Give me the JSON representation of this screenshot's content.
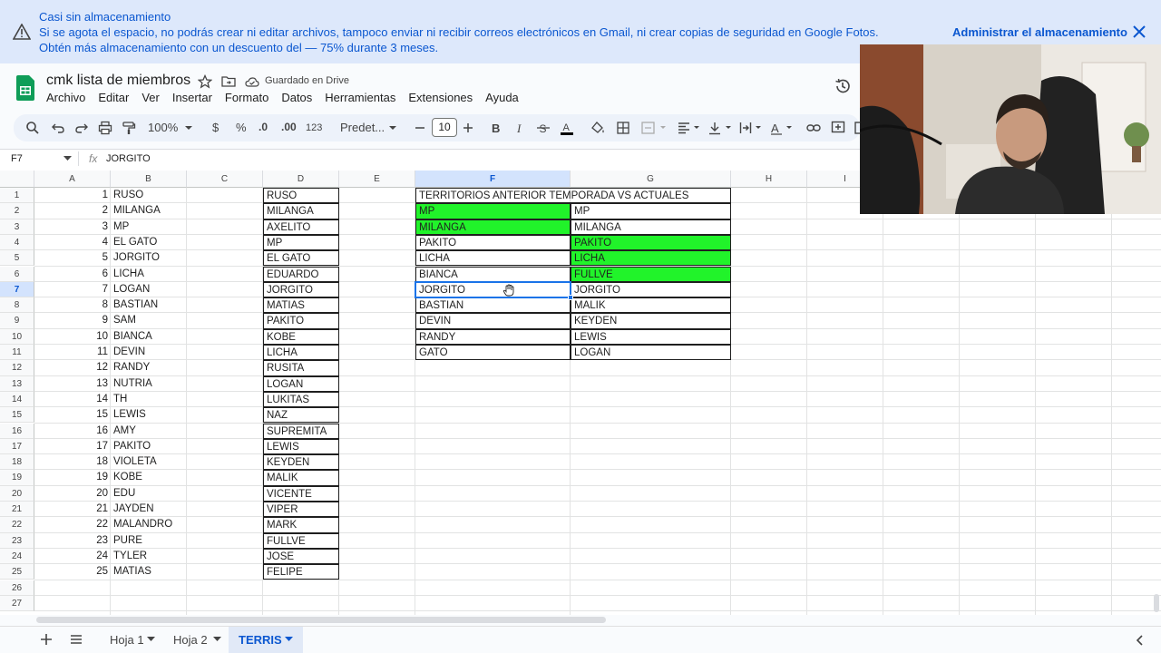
{
  "banner": {
    "title": "Casi sin almacenamiento",
    "message": "Si se agota el espacio, no podrás crear ni editar archivos, tampoco enviar ni recibir correos electrónicos en Gmail, ni crear copias de seguridad en Google Fotos. Obtén más almacenamiento con un descuento del — 75% durante 3 meses.",
    "action": "Administrar el almacenamiento"
  },
  "doc": {
    "title": "cmk lista de miembros",
    "saved": "Guardado en Drive"
  },
  "menu": [
    "Archivo",
    "Editar",
    "Ver",
    "Insertar",
    "Formato",
    "Datos",
    "Herramientas",
    "Extensiones",
    "Ayuda"
  ],
  "toolbar": {
    "zoom": "100%",
    "currency": "$",
    "percent": "%",
    "dec_less": ".0",
    "dec_more": ".00",
    "num_format": "123",
    "font": "Predet...",
    "font_size": "10"
  },
  "formula_bar": {
    "cell_ref": "F7",
    "fx": "fx",
    "value": "JORGITO"
  },
  "columns": [
    "A",
    "B",
    "C",
    "D",
    "E",
    "F",
    "G",
    "H",
    "I"
  ],
  "rows": [
    "1",
    "2",
    "3",
    "4",
    "5",
    "6",
    "7",
    "8",
    "9",
    "10",
    "11",
    "12",
    "13",
    "14",
    "15",
    "16",
    "17",
    "18",
    "19",
    "20",
    "21",
    "22",
    "23",
    "24",
    "25",
    "26",
    "27"
  ],
  "colA": [
    "1",
    "2",
    "3",
    "4",
    "5",
    "6",
    "7",
    "8",
    "9",
    "10",
    "11",
    "12",
    "13",
    "14",
    "15",
    "16",
    "17",
    "18",
    "19",
    "20",
    "21",
    "22",
    "23",
    "24",
    "25"
  ],
  "colB": [
    "RUSO",
    "MILANGA",
    "MP",
    "EL GATO",
    "JORGITO",
    "LICHA",
    "LOGAN",
    "BASTIAN",
    "SAM",
    "BIANCA",
    "DEVIN",
    "RANDY",
    "NUTRIA",
    "TH",
    "LEWIS",
    "AMY",
    "PAKITO",
    "VIOLETA",
    "KOBE",
    "EDU",
    "JAYDEN",
    "MALANDRO",
    "PURE",
    "TYLER",
    "MATIAS"
  ],
  "colD": [
    "RUSO",
    "MILANGA",
    "AXELITO",
    "MP",
    "EL GATO",
    "EDUARDO",
    "JORGITO",
    "MATIAS",
    "PAKITO",
    "KOBE",
    "LICHA",
    "RUSITA",
    "LOGAN",
    "LUKITAS",
    "NAZ",
    "SUPREMITA",
    "LEWIS",
    "KEYDEN",
    "MALIK",
    "VICENTE",
    "VIPER",
    "MARK",
    "FULLVE",
    "JOSE",
    "FELIPE"
  ],
  "f1": "TERRITORIOS ANTERIOR TEMPORADA VS ACTUALES",
  "colF": [
    "MP",
    "MILANGA",
    "PAKITO",
    "LICHA",
    "BIANCA",
    "JORGITO",
    "BASTIAN",
    "DEVIN",
    "RANDY",
    "GATO"
  ],
  "colG": [
    "MP",
    "MILANGA",
    "PAKITO",
    "LICHA",
    "FULLVE",
    "JORGITO",
    "MALIK",
    "KEYDEN",
    "LEWIS",
    "LOGAN"
  ],
  "sheets": [
    "Hoja 1",
    "Hoja 2",
    "TERRIS"
  ],
  "colors": {
    "highlight": "#21f32a",
    "accent": "#0b57d0"
  }
}
